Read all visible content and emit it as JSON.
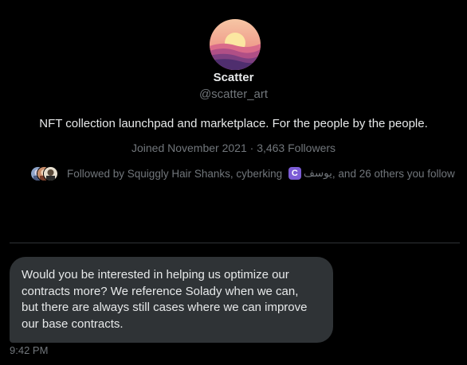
{
  "profile": {
    "display_name": "Scatter",
    "handle": "@scatter_art",
    "bio": "NFT collection launchpad and marketplace. For the people by the people.",
    "joined": "Joined November 2021",
    "separator": " · ",
    "followers": "3,463 Followers",
    "followed_by_prefix": "Followed by Squiggly Hair Shanks, cyberking ",
    "followed_badge": "C",
    "followed_by_name": "يوسف",
    "followed_by_suffix": ", and 26 others you follow"
  },
  "message": {
    "text": "Would you be interested in helping us optimize our\ncontracts more? We reference Solady when we can,\nbut there are always still cases where we can improve\nour base contracts.",
    "time": "9:42 PM"
  },
  "colors": {
    "background": "#000000",
    "primary_text": "#e7e9ea",
    "secondary_text": "#71767b",
    "bubble": "#2f3336",
    "divider": "#2f3336",
    "badge": "#7c5cd6"
  },
  "icons": [
    "profile-avatar",
    "facepile-avatar",
    "verified-badge-icon"
  ]
}
